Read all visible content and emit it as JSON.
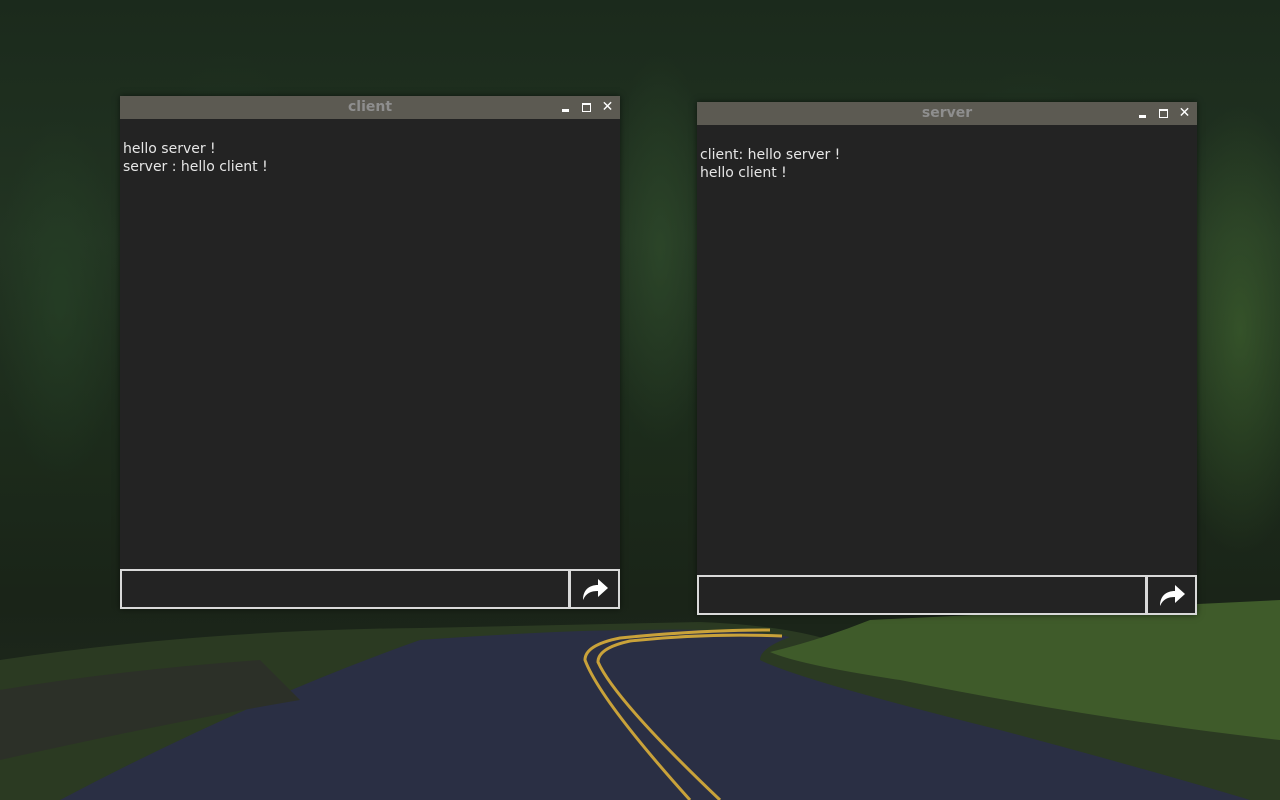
{
  "windows": {
    "client": {
      "title": "client",
      "messages": [
        "hello server !",
        "server : hello client !"
      ],
      "input_value": "",
      "send_icon": "share-arrow-icon"
    },
    "server": {
      "title": "server",
      "messages": [
        "client: hello server !",
        "hello client !"
      ],
      "input_value": "",
      "send_icon": "share-arrow-icon"
    }
  },
  "colors": {
    "titlebar": "#5c5a52",
    "title_text": "#8e8e8e",
    "window_bg": "#232323",
    "text": "#e6e6e6",
    "input_border": "#d9d9d9"
  }
}
